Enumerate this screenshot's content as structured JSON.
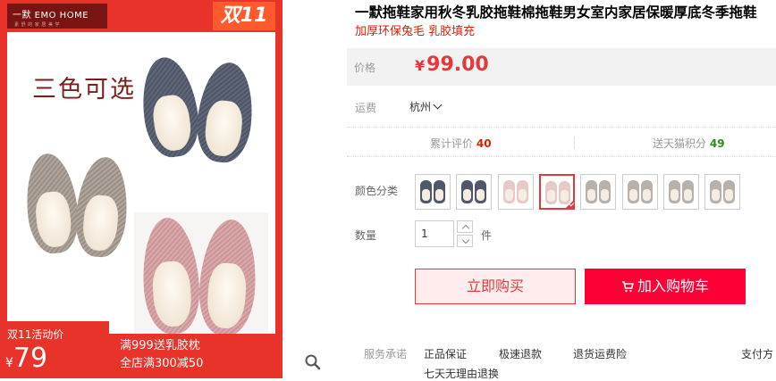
{
  "hero": {
    "brand_name": "一默 EMO HOME",
    "brand_sub": "素 舒 的 家 居 美 学",
    "badge": "双11",
    "three_color": "三色可选",
    "promo_tag_title": "双11活动价",
    "promo_tag_currency": "¥",
    "promo_tag_price": "79",
    "promo_line1": "满999送乳胶枕",
    "promo_line2": "全店满300减50"
  },
  "product": {
    "title": "一默拖鞋家用秋冬乳胶拖鞋棉拖鞋男女室内家居保暖厚底冬季拖鞋",
    "subtitle": "加厚环保兔毛 乳胶填充"
  },
  "price": {
    "label": "价格",
    "currency": "¥",
    "value": "99.00"
  },
  "shipping": {
    "label": "运费",
    "location": "杭州"
  },
  "stats": {
    "review_label": "累计评价",
    "review_count": "40",
    "points_label": "送天猫积分",
    "points_count": "49"
  },
  "colors": {
    "label": "颜色分类",
    "swatches": [
      {
        "name": "navy",
        "selected": false
      },
      {
        "name": "navy",
        "selected": false
      },
      {
        "name": "pink",
        "selected": false
      },
      {
        "name": "pink",
        "selected": true
      },
      {
        "name": "gray",
        "selected": false
      },
      {
        "name": "gray",
        "selected": false
      },
      {
        "name": "gray",
        "selected": false
      },
      {
        "name": "gray",
        "selected": false
      }
    ]
  },
  "quantity": {
    "label": "数量",
    "value": "1",
    "unit": "件"
  },
  "buttons": {
    "buy_now": "立即购买",
    "add_cart": "加入购物车"
  },
  "service": {
    "label": "服务承诺",
    "items": [
      "正品保证",
      "极速退款",
      "退货运费险"
    ],
    "second_line": "七天无理由退换",
    "payment": "支付方"
  },
  "colors_hex": {
    "accent_red": "#e4393c",
    "cart_red": "#ff0036",
    "banner_red": "#e8332a"
  }
}
